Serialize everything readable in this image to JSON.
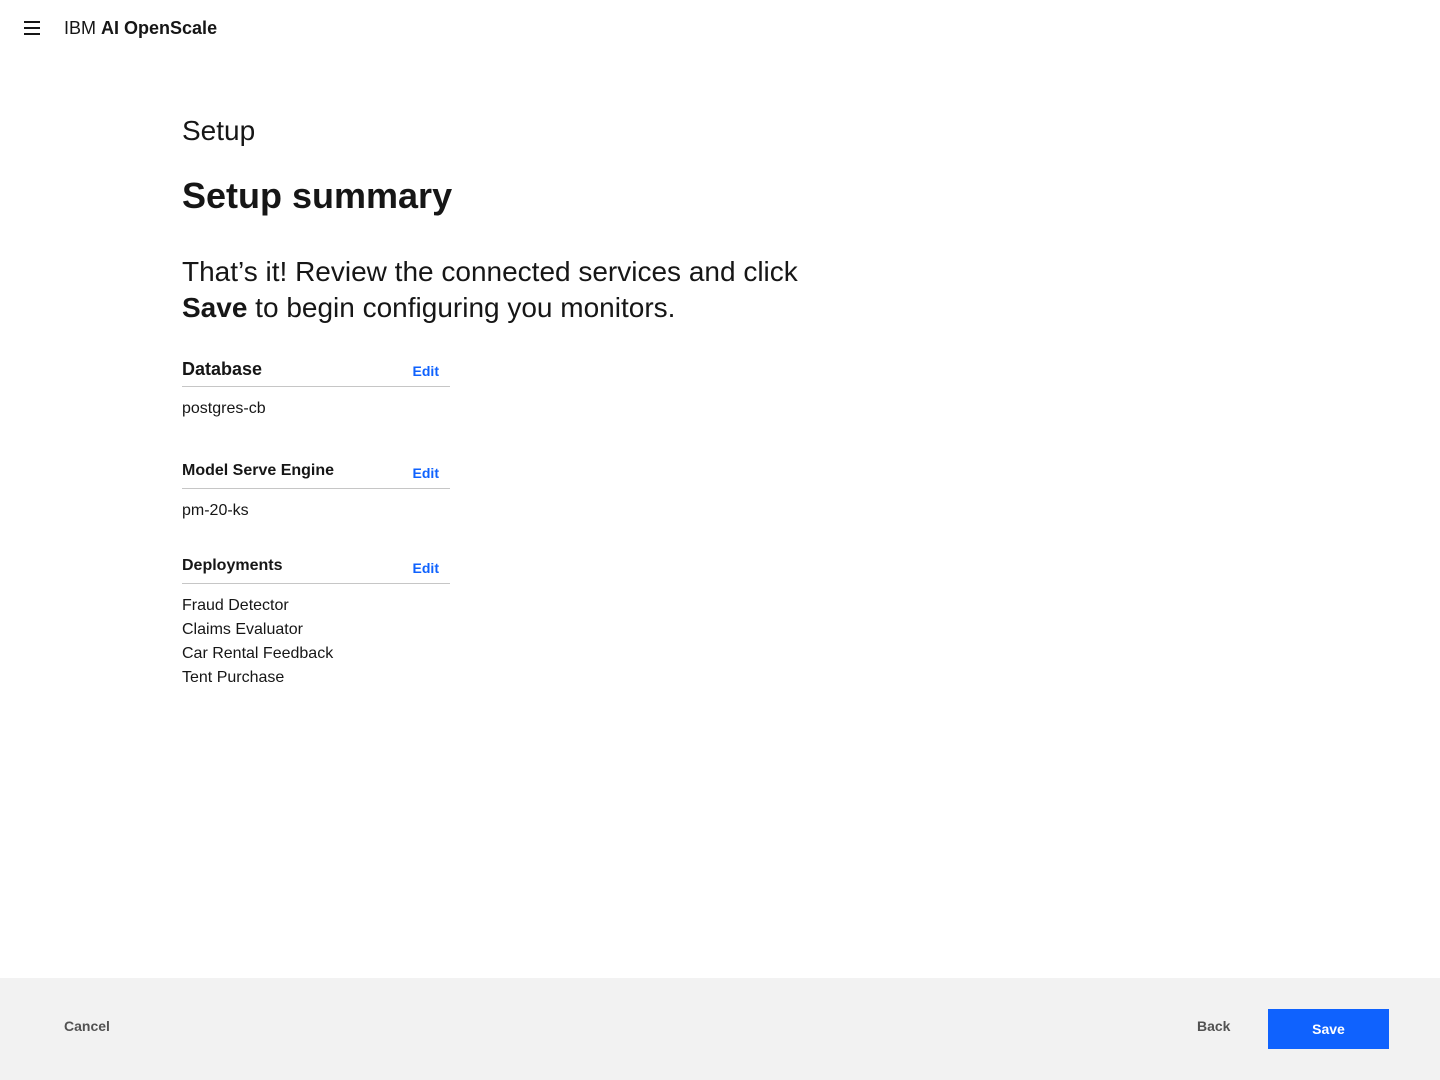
{
  "header": {
    "brand_prefix": "IBM",
    "brand_name": "AI OpenScale",
    "menu_icon": "hamburger-menu-icon"
  },
  "main": {
    "eyebrow": "Setup",
    "title": "Setup summary",
    "lead_line1": "That’s it! Review the connected services and click",
    "lead_bold": "Save",
    "lead_rest": " to begin configuring you monitors."
  },
  "sections": {
    "database": {
      "title": "Database",
      "edit_label": "Edit",
      "items": [
        "postgres-cb"
      ]
    },
    "engine": {
      "title": "Model Serve Engine",
      "edit_label": "Edit",
      "items": [
        "pm-20-ks"
      ]
    },
    "deployments": {
      "title": "Deployments",
      "edit_label": "Edit",
      "items": [
        "Fraud Detector",
        "Claims Evaluator",
        "Car Rental Feedback",
        "Tent Purchase"
      ]
    }
  },
  "footer": {
    "cancel_label": "Cancel",
    "back_label": "Back",
    "save_label": "Save"
  },
  "colors": {
    "primary": "#0f62fe",
    "footer_bg": "#f2f2f2",
    "text": "#161616"
  }
}
